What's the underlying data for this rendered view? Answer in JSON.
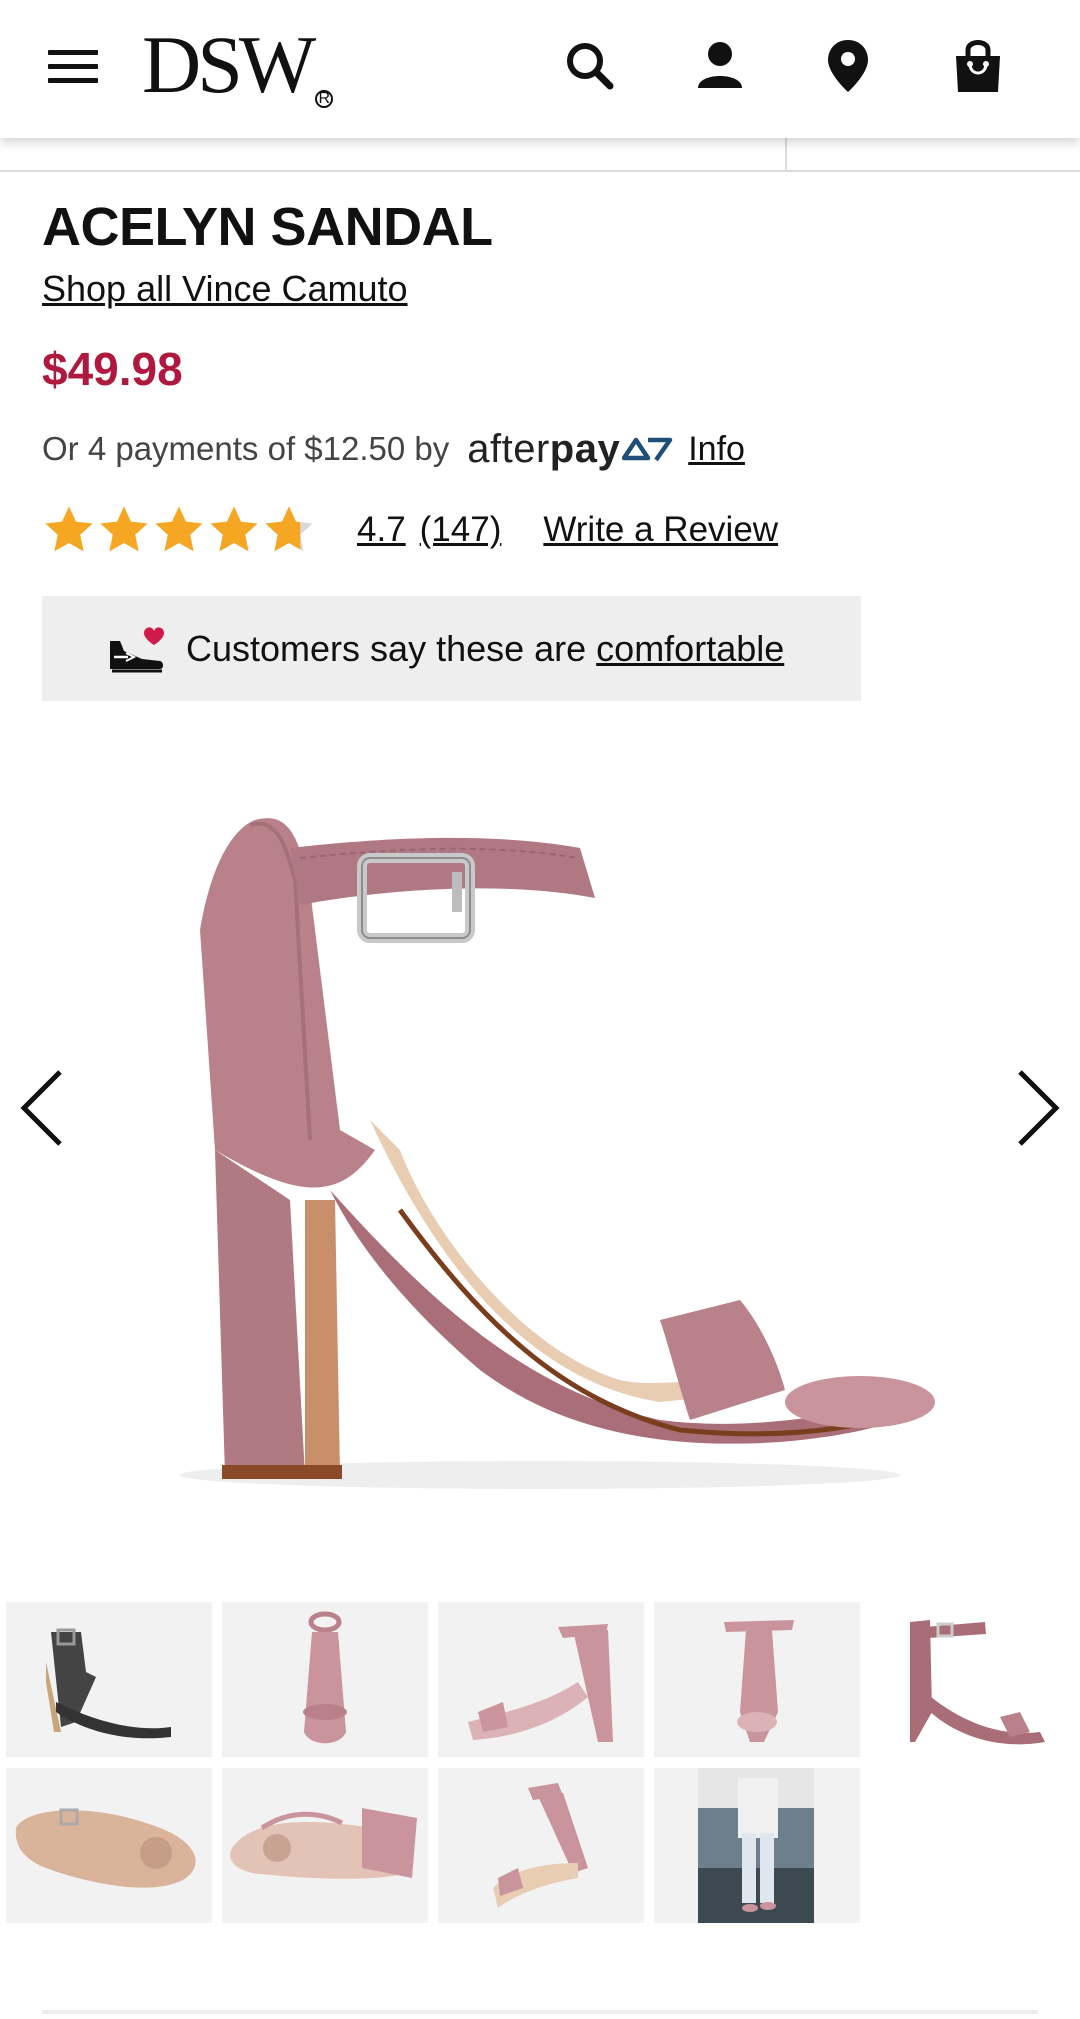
{
  "header": {
    "logo_text": "DSW",
    "logo_mark": "R",
    "icons": [
      "menu-icon",
      "search-icon",
      "account-icon",
      "location-icon",
      "bag-icon"
    ]
  },
  "product": {
    "name": "ACELYN SANDAL",
    "brand_link": "Shop all Vince Camuto",
    "price": "$49.98",
    "afterpay": {
      "text": "Or 4 payments of $12.50 by",
      "logo_light": "after",
      "logo_bold": "pay",
      "info_label": "Info"
    },
    "rating": {
      "value": "4.7",
      "count": "(147)",
      "stars_filled_fraction": 0.94,
      "write_review_label": "Write a Review"
    },
    "comfort": {
      "text": "Customers say these are",
      "link": "comfortable"
    }
  },
  "gallery": {
    "active_index": 4,
    "thumbnail_count": 9
  },
  "colors": {
    "price": "#b0193f",
    "star": "#f5a623",
    "shoe_suede": "#b9828a",
    "comfort_bg": "#eeeeee"
  }
}
